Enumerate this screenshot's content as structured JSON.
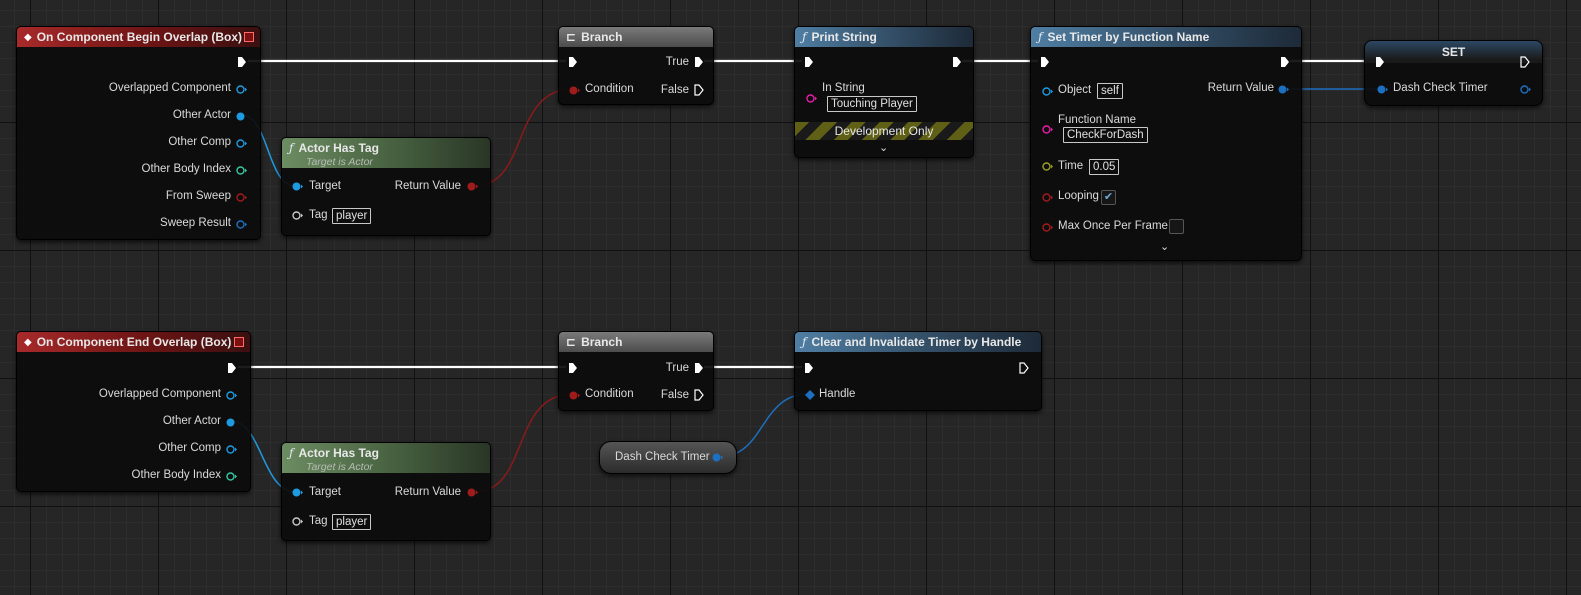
{
  "graph": {
    "begin_overlap": {
      "title": "On Component Begin Overlap (Box)",
      "pins": [
        "Overlapped Component",
        "Other Actor",
        "Other Comp",
        "Other Body Index",
        "From Sweep",
        "Sweep Result"
      ]
    },
    "has_tag_1": {
      "title": "Actor Has Tag",
      "subtitle": "Target is Actor",
      "target": "Target",
      "return_value": "Return Value",
      "tag_label": "Tag",
      "tag_value": "player"
    },
    "branch_1": {
      "title": "Branch",
      "condition": "Condition",
      "true_label": "True",
      "false_label": "False"
    },
    "print_string": {
      "title": "Print String",
      "in_string_label": "In String",
      "in_string_value": "Touching Player",
      "dev_only": "Development Only"
    },
    "set_timer": {
      "title": "Set Timer by Function Name",
      "object_label": "Object",
      "object_value": "self",
      "function_name_label": "Function Name",
      "function_name_value": "CheckForDash",
      "time_label": "Time",
      "time_value": "0.05",
      "looping_label": "Looping",
      "looping_checked": true,
      "max_once_label": "Max Once Per Frame",
      "max_once_checked": false,
      "return_value": "Return Value"
    },
    "set_node": {
      "title": "SET",
      "var_label": "Dash Check Timer"
    },
    "end_overlap": {
      "title": "On Component End Overlap (Box)",
      "pins": [
        "Overlapped Component",
        "Other Actor",
        "Other Comp",
        "Other Body Index"
      ]
    },
    "has_tag_2": {
      "title": "Actor Has Tag",
      "subtitle": "Target is Actor",
      "target": "Target",
      "return_value": "Return Value",
      "tag_label": "Tag",
      "tag_value": "player"
    },
    "branch_2": {
      "title": "Branch",
      "condition": "Condition",
      "true_label": "True",
      "false_label": "False"
    },
    "clear_timer": {
      "title": "Clear and Invalidate Timer by Handle",
      "handle_label": "Handle"
    },
    "var_getter": {
      "label": "Dash Check Timer"
    }
  },
  "icons": {
    "event": "event-diamond-icon",
    "function": "function-f-icon",
    "branch": "branch-icon",
    "exec_pin": "exec-arrow-icon",
    "chevron": "chevron-down-icon"
  },
  "colors": {
    "exec_wire": "#ffffff",
    "object_pin": "#1e9be0",
    "bool_pin": "#a01c1c",
    "string_pin": "#e81ca8",
    "float_pin": "#9aa028",
    "struct_pin": "#1d6fbf",
    "event_header": "#a82a2a",
    "function_header": "#4f7ea3",
    "pure_header": "#6c8c62"
  }
}
